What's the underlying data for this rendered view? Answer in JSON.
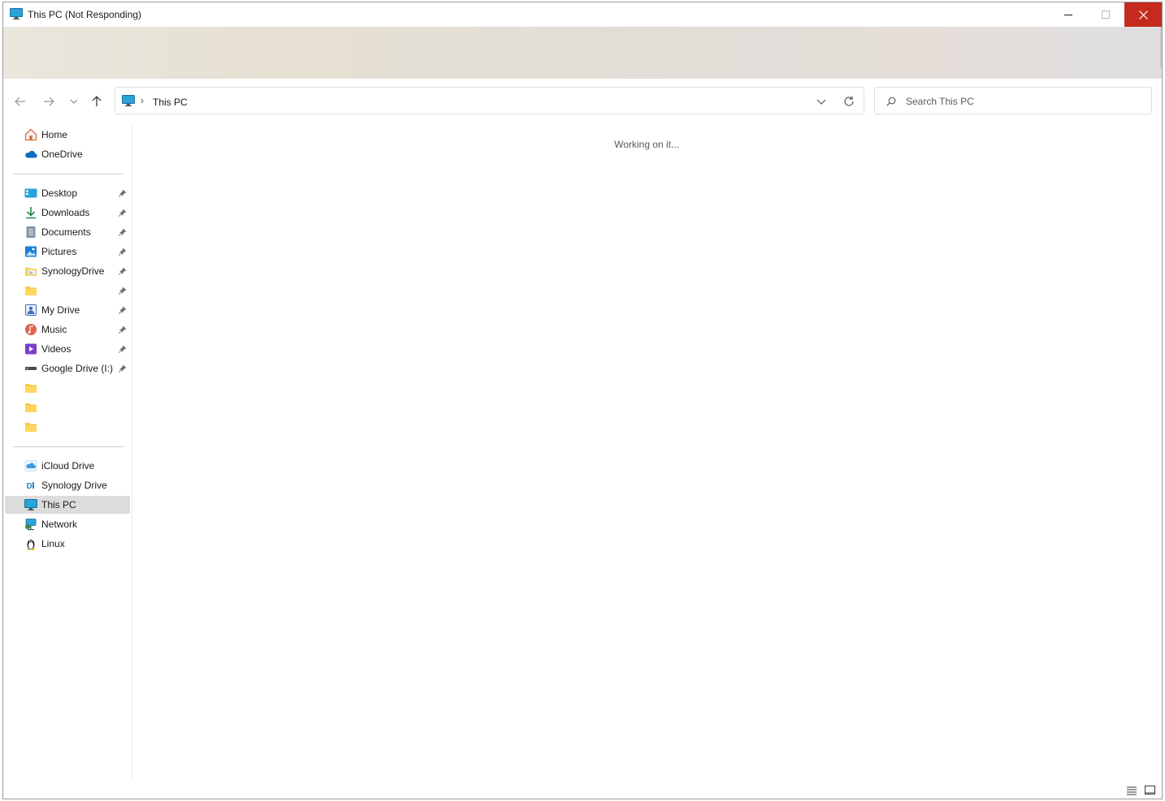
{
  "window": {
    "title": "This PC (Not Responding)",
    "controls": {
      "minimize": "minimize",
      "maximize": "maximize",
      "close": "close"
    },
    "close_color": "#c42b1c"
  },
  "nav": {
    "back": "back",
    "forward": "forward",
    "recent": "recent-locations",
    "up": "up"
  },
  "address": {
    "separator": "›",
    "location": "This PC"
  },
  "search": {
    "placeholder": "Search This PC",
    "value": ""
  },
  "sidebar": {
    "top": [
      {
        "label": "Home",
        "icon": "home-icon"
      },
      {
        "label": "OneDrive",
        "icon": "onedrive-icon"
      }
    ],
    "quick_access": [
      {
        "label": "Desktop",
        "icon": "desktop-icon",
        "pinned": true
      },
      {
        "label": "Downloads",
        "icon": "downloads-icon",
        "pinned": true
      },
      {
        "label": "Documents",
        "icon": "documents-icon",
        "pinned": true
      },
      {
        "label": "Pictures",
        "icon": "pictures-icon",
        "pinned": true
      },
      {
        "label": "SynologyDrive",
        "icon": "synology-folder-icon",
        "pinned": true
      },
      {
        "label": "",
        "icon": "folder-icon",
        "pinned": true
      },
      {
        "label": "My Drive",
        "icon": "my-drive-icon",
        "pinned": true
      },
      {
        "label": "Music",
        "icon": "music-icon",
        "pinned": true
      },
      {
        "label": "Videos",
        "icon": "videos-icon",
        "pinned": true
      },
      {
        "label": "Google Drive (I:)",
        "icon": "drive-icon",
        "pinned": true
      },
      {
        "label": "",
        "icon": "folder-icon",
        "pinned": false
      },
      {
        "label": "",
        "icon": "folder-icon",
        "pinned": false
      },
      {
        "label": "",
        "icon": "folder-icon",
        "pinned": false
      }
    ],
    "locations": [
      {
        "label": "iCloud Drive",
        "icon": "icloud-icon"
      },
      {
        "label": "Synology Drive",
        "icon": "synology-drive-icon"
      },
      {
        "label": "This PC",
        "icon": "this-pc-icon",
        "selected": true
      },
      {
        "label": "Network",
        "icon": "network-icon"
      },
      {
        "label": "Linux",
        "icon": "linux-icon"
      }
    ]
  },
  "main": {
    "status": "Working on it..."
  },
  "statusbar": {
    "details_view": "details-view",
    "tiles_view": "large-icons-view"
  }
}
